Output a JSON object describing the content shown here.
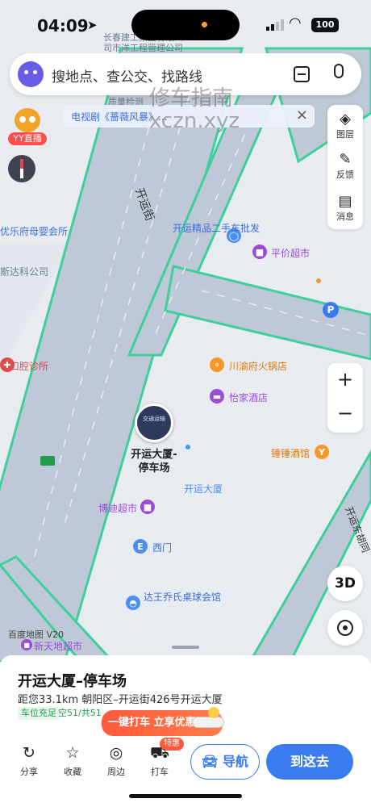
{
  "status_bar": {
    "time": "04:09",
    "battery": "100"
  },
  "search": {
    "placeholder": "搜地点、查公交、找路线"
  },
  "banner": {
    "text": "电视剧《蔷薇风暴》..."
  },
  "watermark": {
    "line1": "修车指南",
    "line2": "xczn.xyz"
  },
  "map_tools": [
    {
      "label": "图层",
      "icon": "layers-icon"
    },
    {
      "label": "反馈",
      "icon": "feedback-icon"
    },
    {
      "label": "消息",
      "icon": "message-icon"
    }
  ],
  "yy_live": {
    "label": "YY直播"
  },
  "zoom": {
    "in": "+",
    "out": "−"
  },
  "btn_3d": "3D",
  "map_labels": {
    "top_company1": "长春建工集团有限公",
    "top_company2": "司市洋工程管理公司",
    "quality": "质量检测",
    "street_kaiyun": "开运街",
    "used_car": "开运精品二手车批发",
    "youle": "优乐府母婴会所",
    "kesi": "斯达科公司",
    "pingjia": "平价超市",
    "dental": "口腔诊所",
    "hotpot": "川渝府火锅店",
    "yijia": "怡家酒店",
    "chuichui": "锤锤酒馆",
    "kaiyun_building": "开运大厦",
    "bodi": "博迪超市",
    "ximen": "西门",
    "kaiyun_east": "开运东胡同",
    "billiards": "达王乔氏桌球会馆",
    "xintiandi": "新天地超市",
    "baidu_map": "百度地图 V20"
  },
  "marker": {
    "name": "开运大厦-停车场",
    "thumb_text": "交通运输"
  },
  "panel": {
    "title": "开运大厦–停车场",
    "address": "距您33.1km  朝阳区–开运街426号开运大厦",
    "parking_badge": "车位充足",
    "parking_stat": "空51/共51",
    "promo": "一键打车 立享优惠",
    "special": "特惠",
    "actions": [
      {
        "label": "分享",
        "icon": "share-icon"
      },
      {
        "label": "收藏",
        "icon": "star-icon"
      },
      {
        "label": "周边",
        "icon": "compass-icon"
      },
      {
        "label": "打车",
        "icon": "taxi-icon"
      }
    ],
    "nav": "导航",
    "go": "到这去"
  }
}
